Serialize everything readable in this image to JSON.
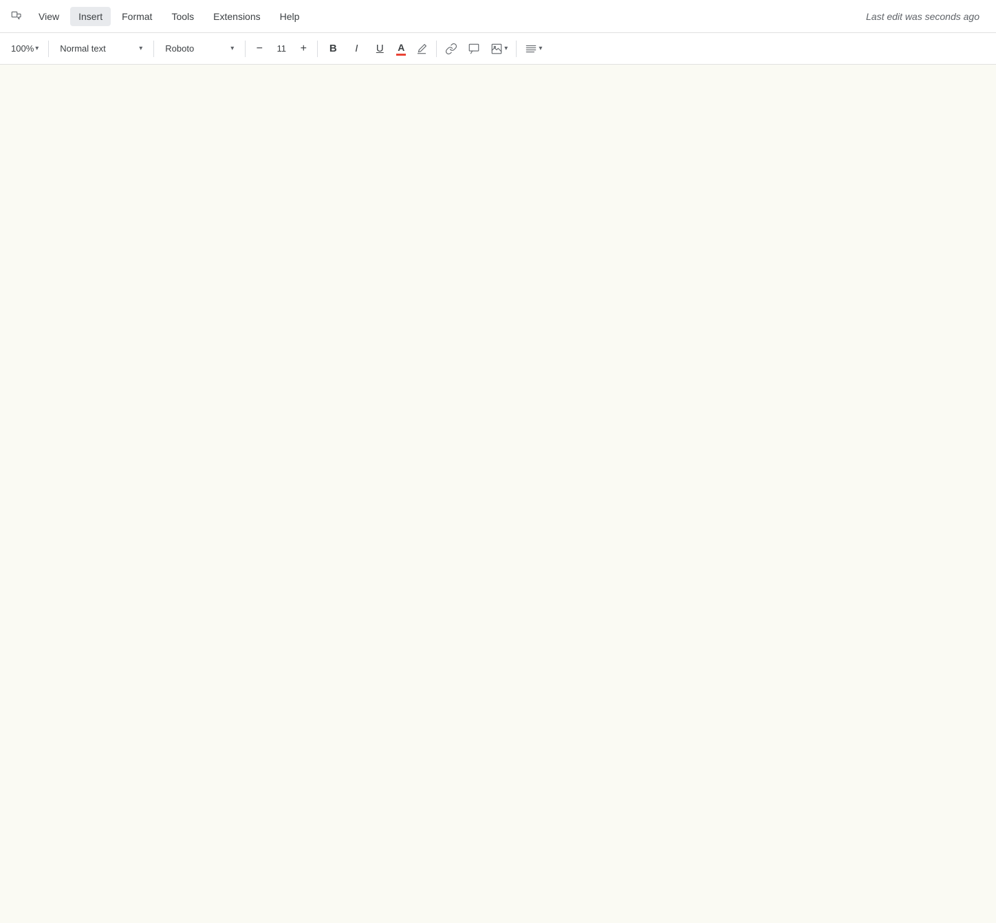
{
  "menu": {
    "items": [
      {
        "id": "view",
        "label": "View"
      },
      {
        "id": "insert",
        "label": "Insert"
      },
      {
        "id": "format",
        "label": "Format"
      },
      {
        "id": "tools",
        "label": "Tools"
      },
      {
        "id": "extensions",
        "label": "Extensions"
      },
      {
        "id": "help",
        "label": "Help"
      }
    ],
    "last_edit": "Last edit was seconds ago"
  },
  "toolbar": {
    "zoom_level": "100%",
    "zoom_chevron": "▾",
    "styles_label": "Normal text",
    "styles_chevron": "▾",
    "font_label": "Roboto",
    "font_chevron": "▾",
    "font_size": "11",
    "decrease_font": "−",
    "increase_font": "+",
    "bold": "B",
    "italic": "I",
    "underline": "U",
    "text_color_letter": "A",
    "highlight_icon": "✏",
    "link_icon": "🔗",
    "comment_icon": "💬",
    "image_icon": "🖼",
    "align_icon": "≡",
    "align_chevron": "▾",
    "more_options": "⋮"
  },
  "document": {
    "background_color": "#fafaf3",
    "content": ""
  }
}
